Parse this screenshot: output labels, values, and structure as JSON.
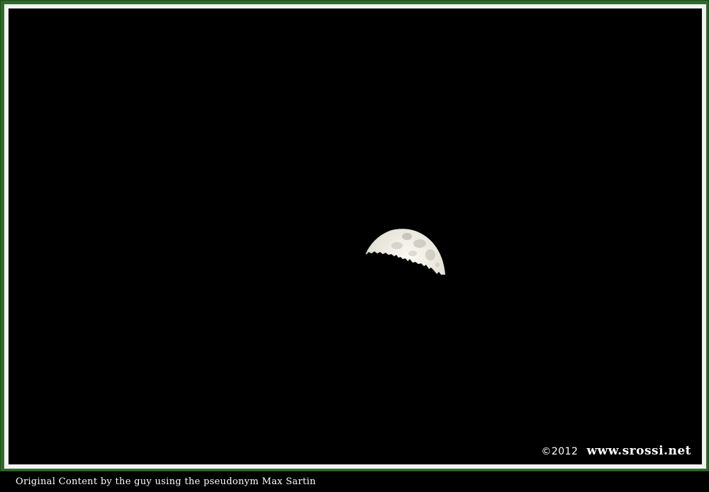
{
  "photo": {
    "subject_icon": "half-moon-over-treeline",
    "background_color": "#000000",
    "frame_color": "#2f6a2c",
    "mat_color": "#f2f2f2"
  },
  "watermark": {
    "year": "©2012",
    "site": "www.srossi.net"
  },
  "caption": {
    "text": "Original Content by the guy using the pseudonym Max Sartin"
  }
}
